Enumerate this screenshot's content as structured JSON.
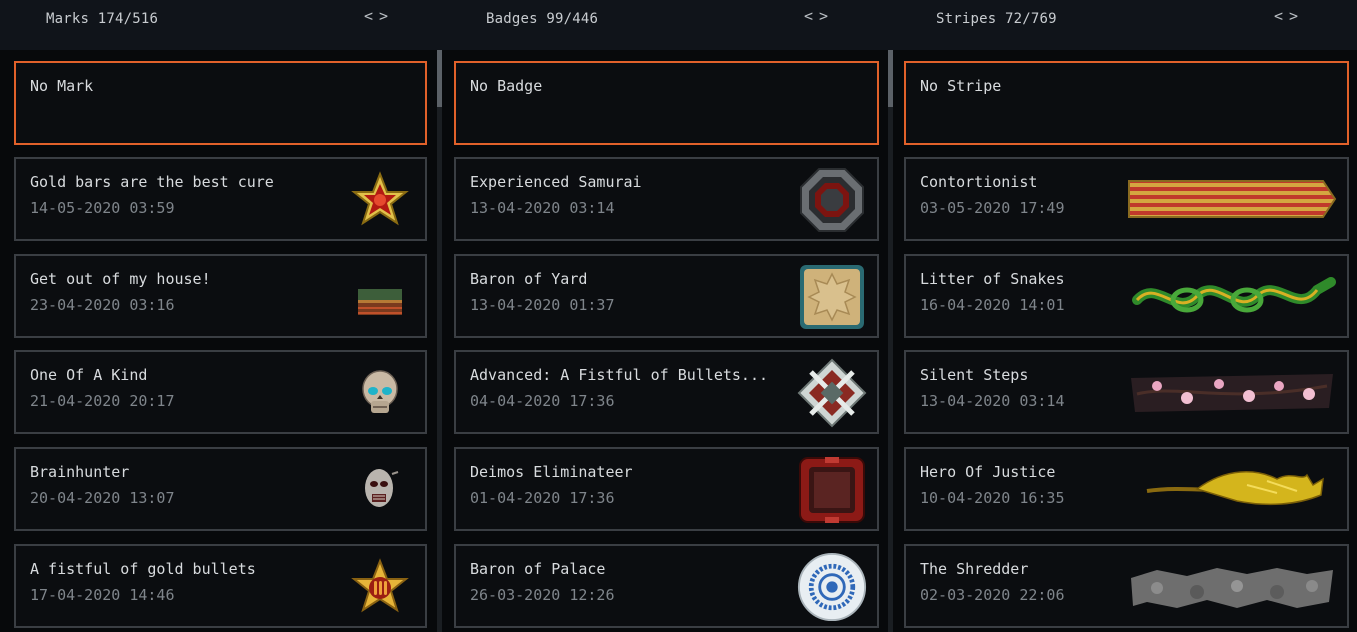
{
  "columns": [
    {
      "title": "Marks 174/516",
      "pager": {
        "prev": "<",
        "next": ">"
      },
      "items": [
        {
          "name": "No Mark",
          "date": "",
          "icon": "none",
          "selected": true
        },
        {
          "name": "Gold bars are the best cure",
          "date": "14-05-2020 03:59",
          "icon": "gold-star-red-cross-icon"
        },
        {
          "name": "Get out of my house!",
          "date": "23-04-2020 03:16",
          "icon": "treasure-chest-icon"
        },
        {
          "name": "One Of A Kind",
          "date": "21-04-2020 20:17",
          "icon": "ornate-skull-icon"
        },
        {
          "name": "Brainhunter",
          "date": "20-04-2020 13:07",
          "icon": "zombie-head-icon"
        },
        {
          "name": "A fistful of gold bullets",
          "date": "17-04-2020 14:46",
          "icon": "gold-star-bullets-icon"
        }
      ]
    },
    {
      "title": "Badges 99/446",
      "pager": {
        "prev": "<",
        "next": ">"
      },
      "items": [
        {
          "name": "No Badge",
          "date": "",
          "icon": "none",
          "selected": true
        },
        {
          "name": "Experienced Samurai",
          "date": "13-04-2020 03:14",
          "icon": "octagon-steel-badge-icon"
        },
        {
          "name": "Baron of Yard",
          "date": "13-04-2020 01:37",
          "icon": "parchment-star-badge-icon"
        },
        {
          "name": "Advanced: A Fistful of Bullets...",
          "date": "04-04-2020 17:36",
          "icon": "crossed-swords-badge-icon"
        },
        {
          "name": "Deimos Eliminateer",
          "date": "01-04-2020 17:36",
          "icon": "red-square-badge-icon"
        },
        {
          "name": "Baron of Palace",
          "date": "26-03-2020 12:26",
          "icon": "porcelain-plate-badge-icon"
        }
      ]
    },
    {
      "title": "Stripes 72/769",
      "pager": {
        "prev": "<",
        "next": ">"
      },
      "items": [
        {
          "name": "No Stripe",
          "date": "",
          "icon": "none",
          "selected": true
        },
        {
          "name": "Contortionist",
          "date": "03-05-2020 17:49",
          "icon": "striped-ribbon-icon"
        },
        {
          "name": "Litter of Snakes",
          "date": "16-04-2020 14:01",
          "icon": "green-snakes-stripe-icon"
        },
        {
          "name": "Silent Steps",
          "date": "13-04-2020 03:14",
          "icon": "cherry-blossom-stripe-icon"
        },
        {
          "name": "Hero Of Justice",
          "date": "10-04-2020 16:35",
          "icon": "gold-bat-stripe-icon"
        },
        {
          "name": "The Shredder",
          "date": "02-03-2020 22:06",
          "icon": "rubble-stripe-icon"
        }
      ]
    }
  ]
}
